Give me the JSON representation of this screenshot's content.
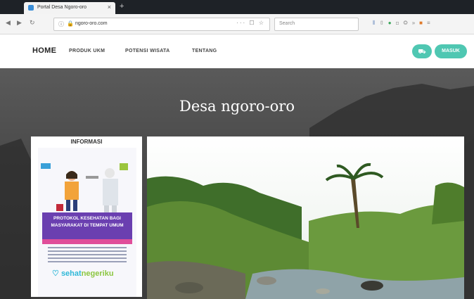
{
  "browser": {
    "tab_title": "Portal Desa Ngoro-oro",
    "tab_close": "×",
    "new_tab": "+",
    "nav_icons": [
      "back-icon",
      "forward-icon",
      "reload-icon"
    ],
    "url": "ngoro-oro.com",
    "url_actions": "··· ☐ ☆",
    "search_placeholder": "Search",
    "toolbar_icons": [
      "library-icon",
      "sidebar-icon",
      "extension-icon",
      "pocket-icon",
      "sync-icon",
      "menu-icon"
    ]
  },
  "site": {
    "nav": {
      "home": "HOME",
      "produk": "PRODUK UKM",
      "potensi": "POTENSI WISATA",
      "tentang": "TENTANG"
    },
    "cart_icon": "cart-icon",
    "login_label": "MASUK",
    "accent_color": "#4fc7b2",
    "hero_title": "Desa ngoro-oro",
    "info": {
      "title": "INFORMASI",
      "poster_banner": "PROTOKOL KESEHATAN BAGI MASYARAKAT DI TEMPAT UMUM",
      "poster_brand_1": "sehat",
      "poster_brand_2": "negeriku"
    }
  }
}
